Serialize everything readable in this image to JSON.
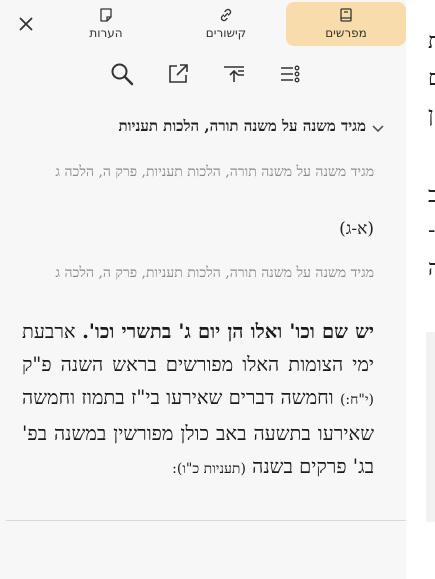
{
  "tabs": [
    {
      "label": "מפרשים",
      "icon": "book-icon",
      "active": true
    },
    {
      "label": "קישורים",
      "icon": "link-icon",
      "active": false
    },
    {
      "label": "הערות",
      "icon": "note-icon",
      "active": false
    }
  ],
  "header": {
    "title": "מגיד משנה על משנה תורה, הלכות תעניות"
  },
  "refs": [
    {
      "citation": "מגיד משנה על משנה תורה, הלכות תעניות, פרק ה, הלכה ג",
      "number": "(א-ג)"
    },
    {
      "citation": "מגיד משנה על משנה תורה, הלכות תעניות, פרק ה, הלכה ג"
    }
  ],
  "body": {
    "bold_part": "יש שם וכו' ואלו הן יום ג' בתשרי וכו'.",
    "text_part": " ארבעת ימי הצומות האלו מפורשים בראש השנה פ\"ק ",
    "small1": "(י\"ח:)",
    "text_part2": " וחמשה דברים שאירעו בי\"ז בתמוז וחמשה שאירעו בתשעה באב כולן מפורשין במשנה בפ' בג' פרקים בשנה",
    "small2": "(תעניות כ\"ו):"
  },
  "colors": {
    "accent": "#f9dcab",
    "panel": "#f7f7f7"
  }
}
